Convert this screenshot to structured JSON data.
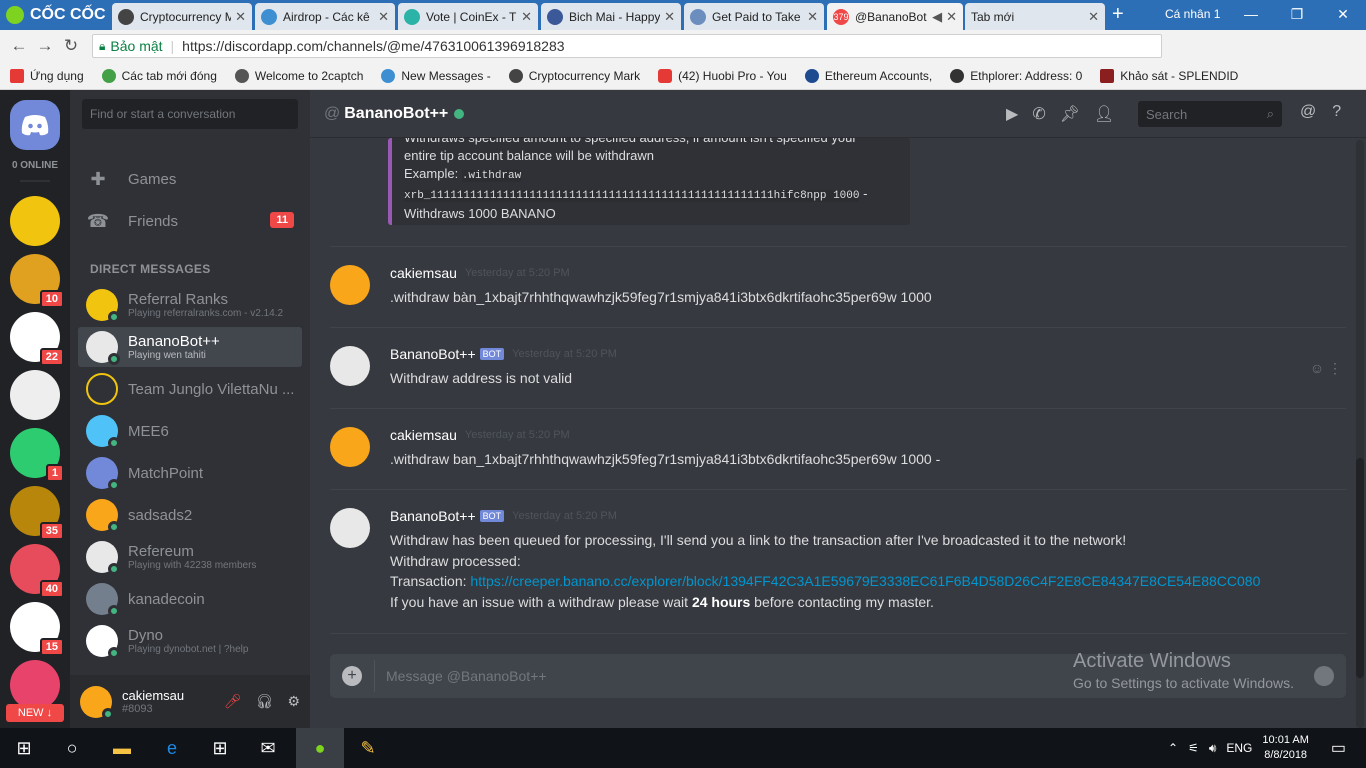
{
  "browser": {
    "logo": "CỐC CỐC",
    "tabs": [
      {
        "label": "Cryptocurrency M",
        "color": "#444"
      },
      {
        "label": "Airdrop - Các kê",
        "color": "#3d8fd1"
      },
      {
        "label": "Vote | CoinEx - Tí",
        "color": "#2bb3a7"
      },
      {
        "label": "Bich Mai - Happy",
        "color": "#3b5998"
      },
      {
        "label": "Get Paid to Take",
        "color": "#6c8ebf"
      },
      {
        "label": "@BananoBot",
        "color": "#f04747",
        "badge": "379"
      },
      {
        "label": "Tab mới",
        "color": "#ccc"
      }
    ],
    "profile": "Cá nhân 1",
    "address": {
      "secure": "Bảo mật",
      "url": "https://discordapp.com/channels/@me/476310061396918283"
    },
    "bookmarks": [
      {
        "label": "Ứng dụng",
        "color": "#e53935"
      },
      {
        "label": "Các tab mới đóng",
        "color": "#43a047"
      },
      {
        "label": "Welcome to 2captch",
        "color": "#555"
      },
      {
        "label": "New Messages -",
        "color": "#3d8fd1"
      },
      {
        "label": "Cryptocurrency Mark",
        "color": "#444"
      },
      {
        "label": "(42) Huobi Pro - You",
        "color": "#e53935"
      },
      {
        "label": "Ethereum Accounts,",
        "color": "#1e4b8f"
      },
      {
        "label": "Ethplorer: Address: 0",
        "color": "#333"
      },
      {
        "label": "Khảo sát - SPLENDID",
        "color": "#8b1e1e"
      }
    ]
  },
  "guilds": {
    "online": "0 ONLINE",
    "items": [
      {
        "color": "#f1c40f",
        "badge": ""
      },
      {
        "color": "#e0a020",
        "badge": "10"
      },
      {
        "color": "#ffffff",
        "badge": "22"
      },
      {
        "color": "#eeeeee",
        "badge": ""
      },
      {
        "color": "#2ecc71",
        "badge": "1"
      },
      {
        "color": "#b8860b",
        "badge": "35"
      },
      {
        "color": "#e74c5c",
        "badge": "40"
      },
      {
        "color": "#ffffff",
        "badge": "15"
      },
      {
        "color": "#e8436b",
        "badge": ""
      }
    ],
    "new_label": "NEW ↓"
  },
  "sidebar": {
    "search_placeholder": "Find or start a conversation",
    "games": "Games",
    "friends": "Friends",
    "friends_badge": "11",
    "dm_header": "DIRECT MESSAGES",
    "dms": [
      {
        "name": "Referral Ranks",
        "sub": "Playing referralranks.com - v2.14.2",
        "color": "#f1c40f"
      },
      {
        "name": "BananoBot++",
        "sub": "Playing wen tahiti",
        "color": "#e8e8e8"
      },
      {
        "name": "Team Junglo VilettaNu ...",
        "sub": "",
        "color": "#2f3136"
      },
      {
        "name": "MEE6",
        "sub": "",
        "color": "#4fc3f7"
      },
      {
        "name": "MatchPoint",
        "sub": "",
        "color": "#7289da"
      },
      {
        "name": "sadsads2",
        "sub": "",
        "color": "#faa61a"
      },
      {
        "name": "Refereum",
        "sub": "Playing with 42238 members",
        "color": "#e8e8e8"
      },
      {
        "name": "kanadecoin",
        "sub": "",
        "color": "#747f8d"
      },
      {
        "name": "Dyno",
        "sub": "Playing dynobot.net | ?help",
        "color": "#ffffff"
      }
    ]
  },
  "user": {
    "name": "cakiemsau",
    "tag": "#8093"
  },
  "chat": {
    "title": "BananoBot++",
    "search": "Search",
    "embed": {
      "line1": "Withdraws specified amount to specified address, if amount isn't specified your",
      "line2": "entire tip account balance will be withdrawn",
      "line3a": "Example: ",
      "line3b": ".withdraw",
      "line4": "xrb_1111111111111111111111111111111111111111111111111111hifc8npp 1000",
      "line4b": " -",
      "line5": "Withdraws 1000 BANANO"
    },
    "messages": [
      {
        "author": "cakiemsau",
        "time": "Yesterday at 5:20 PM",
        "body": ".withdraw bàn_1xbajt7rhhthqwawhzjk59feg7r1smjya841i3btx6dkrtifaohc35per69w 1000"
      },
      {
        "author": "BananoBot++",
        "bot": "BOT",
        "time": "Yesterday at 5:20 PM",
        "body": "Withdraw address is not valid"
      },
      {
        "author": "cakiemsau",
        "time": "Yesterday at 5:20 PM",
        "body": ".withdraw ban_1xbajt7rhhthqwawhzjk59feg7r1smjya841i3btx6dkrtifaohc35per69w 1000 -"
      },
      {
        "author": "BananoBot++",
        "bot": "BOT",
        "time": "Yesterday at 5:20 PM",
        "line1": "Withdraw has been queued for processing, I'll send you a link to the transaction after I've broadcasted it to the network!",
        "line2": "Withdraw processed:",
        "line3a": "Transaction: ",
        "line3b": "https://creeper.banano.cc/explorer/block/1394FF42C3A1E59679E3338EC61F6B4D58D26C4F2E8CE84347E8CE54E88CC080",
        "line4a": "If you have an issue with a withdraw please wait ",
        "line4b": "24 hours",
        "line4c": " before contacting my master."
      }
    ],
    "composer_placeholder": "Message @BananoBot++"
  },
  "watermark": {
    "line1": "Activate Windows",
    "line2": "Go to Settings to activate Windows."
  },
  "taskbar": {
    "lang": "ENG",
    "time": "10:01 AM",
    "date": "8/8/2018"
  }
}
